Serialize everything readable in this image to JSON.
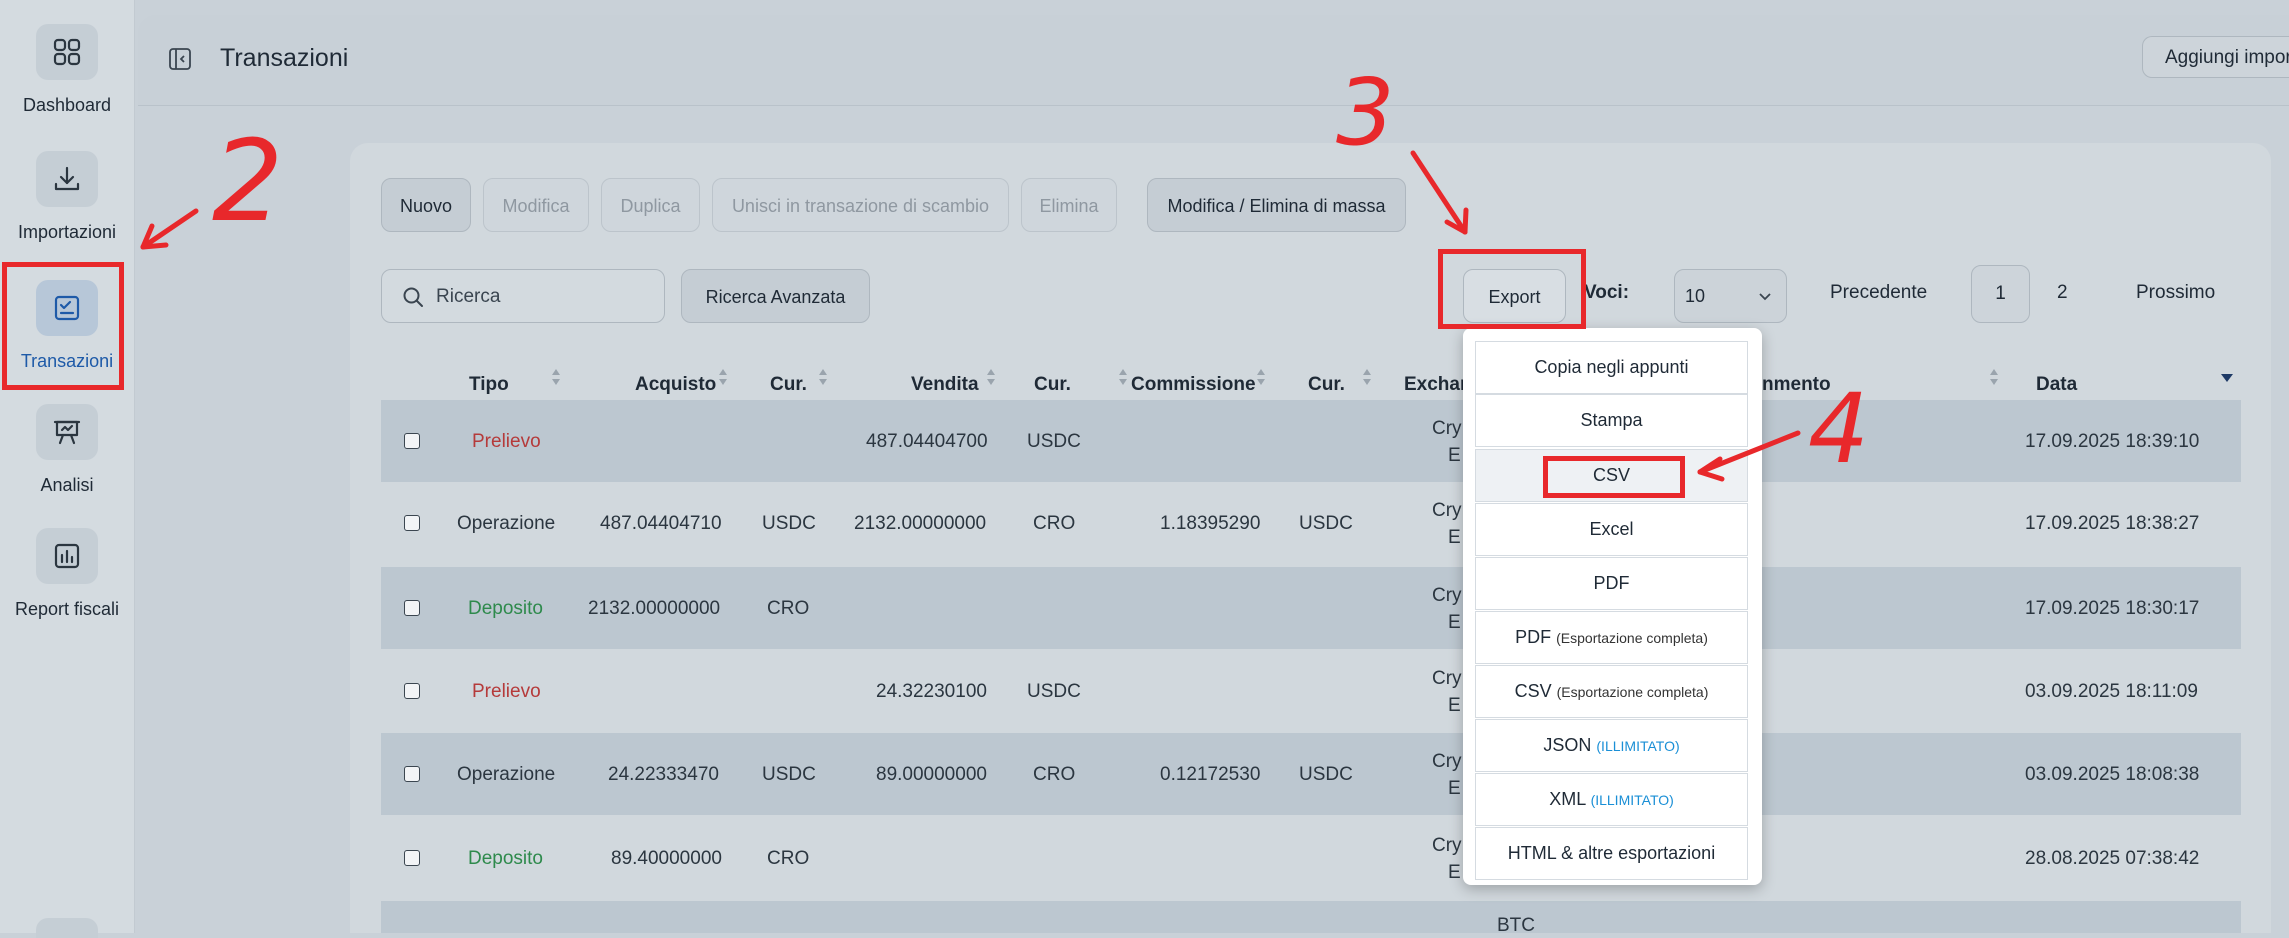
{
  "sidebar": {
    "items": [
      {
        "label": "Dashboard",
        "icon": "dashboard-grid-icon"
      },
      {
        "label": "Importazioni",
        "icon": "download-icon"
      },
      {
        "label": "Transazioni",
        "icon": "transactions-checklist-icon",
        "active": true
      },
      {
        "label": "Analisi",
        "icon": "presentation-board-icon"
      },
      {
        "label": "Report fiscali",
        "icon": "bar-chart-report-icon"
      }
    ]
  },
  "header": {
    "title": "Transazioni",
    "add_import_label": "Aggiungi impor"
  },
  "toolbar": {
    "new_label": "Nuovo",
    "edit_label": "Modifica",
    "duplicate_label": "Duplica",
    "merge_label": "Unisci in transazione di scambio",
    "delete_label": "Elimina",
    "bulk_label": "Modifica / Elimina di massa",
    "search_placeholder": "Ricerca",
    "advanced_search_label": "Ricerca Avanzata",
    "export_label": "Export",
    "voci_label": "Voci:",
    "voci_value": "10",
    "prev_label": "Precedente",
    "page_current": "1",
    "page_next": "2",
    "next_label": "Prossimo"
  },
  "table": {
    "headers": {
      "tipo": "Tipo",
      "acquisto": "Acquisto",
      "cur1": "Cur.",
      "vendita": "Vendita",
      "cur2": "Cur.",
      "commissione": "Commissione",
      "cur3": "Cur.",
      "exchange": "Exchar",
      "commento": "nmento",
      "data": "Data"
    },
    "rows": [
      {
        "tipo": "Prelievo",
        "acquisto": "",
        "cur1": "",
        "vendita": "487.04404700",
        "cur2": "USDC",
        "commissione": "",
        "cur3": "",
        "exch1": "Cry",
        "exch2": "E",
        "data": "17.09.2025 18:39:10"
      },
      {
        "tipo": "Operazione",
        "acquisto": "487.04404710",
        "cur1": "USDC",
        "vendita": "2132.00000000",
        "cur2": "CRO",
        "commissione": "1.18395290",
        "cur3": "USDC",
        "exch1": "Cry",
        "exch2": "E",
        "data": "17.09.2025 18:38:27"
      },
      {
        "tipo": "Deposito",
        "acquisto": "2132.00000000",
        "cur1": "CRO",
        "vendita": "",
        "cur2": "",
        "commissione": "",
        "cur3": "",
        "exch1": "Cry",
        "exch2": "E",
        "data": "17.09.2025 18:30:17"
      },
      {
        "tipo": "Prelievo",
        "acquisto": "",
        "cur1": "",
        "vendita": "24.32230100",
        "cur2": "USDC",
        "commissione": "",
        "cur3": "",
        "exch1": "Cry",
        "exch2": "E",
        "data": "03.09.2025 18:11:09"
      },
      {
        "tipo": "Operazione",
        "acquisto": "24.22333470",
        "cur1": "USDC",
        "vendita": "89.00000000",
        "cur2": "CRO",
        "commissione": "0.12172530",
        "cur3": "USDC",
        "exch1": "Cry",
        "exch2": "E",
        "data": "03.09.2025 18:08:38"
      },
      {
        "tipo": "Deposito",
        "acquisto": "89.40000000",
        "cur1": "CRO",
        "vendita": "",
        "cur2": "",
        "commissione": "",
        "cur3": "",
        "exch1": "Cry",
        "exch2": "E",
        "data": "28.08.2025 07:38:42"
      }
    ],
    "partial_row_text": "BTC"
  },
  "export_menu": {
    "items": [
      {
        "label": "Copia negli appunti",
        "note": ""
      },
      {
        "label": "Stampa",
        "note": ""
      },
      {
        "label": "CSV",
        "note": ""
      },
      {
        "label": "Excel",
        "note": ""
      },
      {
        "label": "PDF",
        "note": ""
      },
      {
        "label": "PDF",
        "note": "(Esportazione completa)"
      },
      {
        "label": "CSV",
        "note": "(Esportazione completa)"
      },
      {
        "label": "JSON",
        "note": "(ILLIMITATO)"
      },
      {
        "label": "XML",
        "note": "(ILLIMITATO)"
      },
      {
        "label": "HTML & altre esportazioni",
        "note": ""
      }
    ]
  },
  "annotations": {
    "step2": "2",
    "step3": "3",
    "step4": "4"
  },
  "colors": {
    "annotation_red": "#e8282b",
    "active_blue": "#1e5aa8",
    "withdrawal_red": "#b53a3a",
    "deposit_green": "#2e8a4c",
    "unlimited_blue": "#1a8fd6"
  }
}
